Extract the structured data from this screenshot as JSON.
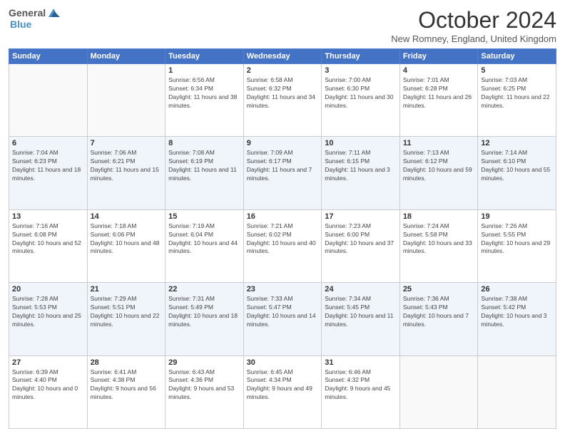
{
  "logo": {
    "text_general": "General",
    "text_blue": "Blue"
  },
  "header": {
    "month": "October 2024",
    "location": "New Romney, England, United Kingdom"
  },
  "weekdays": [
    "Sunday",
    "Monday",
    "Tuesday",
    "Wednesday",
    "Thursday",
    "Friday",
    "Saturday"
  ],
  "weeks": [
    [
      {
        "day": "",
        "sunrise": "",
        "sunset": "",
        "daylight": ""
      },
      {
        "day": "",
        "sunrise": "",
        "sunset": "",
        "daylight": ""
      },
      {
        "day": "1",
        "sunrise": "Sunrise: 6:56 AM",
        "sunset": "Sunset: 6:34 PM",
        "daylight": "Daylight: 11 hours and 38 minutes."
      },
      {
        "day": "2",
        "sunrise": "Sunrise: 6:58 AM",
        "sunset": "Sunset: 6:32 PM",
        "daylight": "Daylight: 11 hours and 34 minutes."
      },
      {
        "day": "3",
        "sunrise": "Sunrise: 7:00 AM",
        "sunset": "Sunset: 6:30 PM",
        "daylight": "Daylight: 11 hours and 30 minutes."
      },
      {
        "day": "4",
        "sunrise": "Sunrise: 7:01 AM",
        "sunset": "Sunset: 6:28 PM",
        "daylight": "Daylight: 11 hours and 26 minutes."
      },
      {
        "day": "5",
        "sunrise": "Sunrise: 7:03 AM",
        "sunset": "Sunset: 6:25 PM",
        "daylight": "Daylight: 11 hours and 22 minutes."
      }
    ],
    [
      {
        "day": "6",
        "sunrise": "Sunrise: 7:04 AM",
        "sunset": "Sunset: 6:23 PM",
        "daylight": "Daylight: 11 hours and 18 minutes."
      },
      {
        "day": "7",
        "sunrise": "Sunrise: 7:06 AM",
        "sunset": "Sunset: 6:21 PM",
        "daylight": "Daylight: 11 hours and 15 minutes."
      },
      {
        "day": "8",
        "sunrise": "Sunrise: 7:08 AM",
        "sunset": "Sunset: 6:19 PM",
        "daylight": "Daylight: 11 hours and 11 minutes."
      },
      {
        "day": "9",
        "sunrise": "Sunrise: 7:09 AM",
        "sunset": "Sunset: 6:17 PM",
        "daylight": "Daylight: 11 hours and 7 minutes."
      },
      {
        "day": "10",
        "sunrise": "Sunrise: 7:11 AM",
        "sunset": "Sunset: 6:15 PM",
        "daylight": "Daylight: 11 hours and 3 minutes."
      },
      {
        "day": "11",
        "sunrise": "Sunrise: 7:13 AM",
        "sunset": "Sunset: 6:12 PM",
        "daylight": "Daylight: 10 hours and 59 minutes."
      },
      {
        "day": "12",
        "sunrise": "Sunrise: 7:14 AM",
        "sunset": "Sunset: 6:10 PM",
        "daylight": "Daylight: 10 hours and 55 minutes."
      }
    ],
    [
      {
        "day": "13",
        "sunrise": "Sunrise: 7:16 AM",
        "sunset": "Sunset: 6:08 PM",
        "daylight": "Daylight: 10 hours and 52 minutes."
      },
      {
        "day": "14",
        "sunrise": "Sunrise: 7:18 AM",
        "sunset": "Sunset: 6:06 PM",
        "daylight": "Daylight: 10 hours and 48 minutes."
      },
      {
        "day": "15",
        "sunrise": "Sunrise: 7:19 AM",
        "sunset": "Sunset: 6:04 PM",
        "daylight": "Daylight: 10 hours and 44 minutes."
      },
      {
        "day": "16",
        "sunrise": "Sunrise: 7:21 AM",
        "sunset": "Sunset: 6:02 PM",
        "daylight": "Daylight: 10 hours and 40 minutes."
      },
      {
        "day": "17",
        "sunrise": "Sunrise: 7:23 AM",
        "sunset": "Sunset: 6:00 PM",
        "daylight": "Daylight: 10 hours and 37 minutes."
      },
      {
        "day": "18",
        "sunrise": "Sunrise: 7:24 AM",
        "sunset": "Sunset: 5:58 PM",
        "daylight": "Daylight: 10 hours and 33 minutes."
      },
      {
        "day": "19",
        "sunrise": "Sunrise: 7:26 AM",
        "sunset": "Sunset: 5:55 PM",
        "daylight": "Daylight: 10 hours and 29 minutes."
      }
    ],
    [
      {
        "day": "20",
        "sunrise": "Sunrise: 7:28 AM",
        "sunset": "Sunset: 5:53 PM",
        "daylight": "Daylight: 10 hours and 25 minutes."
      },
      {
        "day": "21",
        "sunrise": "Sunrise: 7:29 AM",
        "sunset": "Sunset: 5:51 PM",
        "daylight": "Daylight: 10 hours and 22 minutes."
      },
      {
        "day": "22",
        "sunrise": "Sunrise: 7:31 AM",
        "sunset": "Sunset: 5:49 PM",
        "daylight": "Daylight: 10 hours and 18 minutes."
      },
      {
        "day": "23",
        "sunrise": "Sunrise: 7:33 AM",
        "sunset": "Sunset: 5:47 PM",
        "daylight": "Daylight: 10 hours and 14 minutes."
      },
      {
        "day": "24",
        "sunrise": "Sunrise: 7:34 AM",
        "sunset": "Sunset: 5:45 PM",
        "daylight": "Daylight: 10 hours and 11 minutes."
      },
      {
        "day": "25",
        "sunrise": "Sunrise: 7:36 AM",
        "sunset": "Sunset: 5:43 PM",
        "daylight": "Daylight: 10 hours and 7 minutes."
      },
      {
        "day": "26",
        "sunrise": "Sunrise: 7:38 AM",
        "sunset": "Sunset: 5:42 PM",
        "daylight": "Daylight: 10 hours and 3 minutes."
      }
    ],
    [
      {
        "day": "27",
        "sunrise": "Sunrise: 6:39 AM",
        "sunset": "Sunset: 4:40 PM",
        "daylight": "Daylight: 10 hours and 0 minutes."
      },
      {
        "day": "28",
        "sunrise": "Sunrise: 6:41 AM",
        "sunset": "Sunset: 4:38 PM",
        "daylight": "Daylight: 9 hours and 56 minutes."
      },
      {
        "day": "29",
        "sunrise": "Sunrise: 6:43 AM",
        "sunset": "Sunset: 4:36 PM",
        "daylight": "Daylight: 9 hours and 53 minutes."
      },
      {
        "day": "30",
        "sunrise": "Sunrise: 6:45 AM",
        "sunset": "Sunset: 4:34 PM",
        "daylight": "Daylight: 9 hours and 49 minutes."
      },
      {
        "day": "31",
        "sunrise": "Sunrise: 6:46 AM",
        "sunset": "Sunset: 4:32 PM",
        "daylight": "Daylight: 9 hours and 45 minutes."
      },
      {
        "day": "",
        "sunrise": "",
        "sunset": "",
        "daylight": ""
      },
      {
        "day": "",
        "sunrise": "",
        "sunset": "",
        "daylight": ""
      }
    ]
  ]
}
